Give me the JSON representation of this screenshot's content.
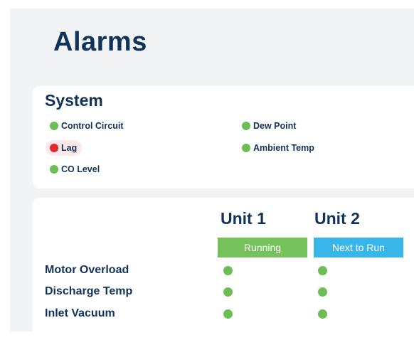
{
  "page": {
    "title": "Alarms"
  },
  "system": {
    "title": "System",
    "alarms": [
      {
        "label": "Control Circuit",
        "status": "ok"
      },
      {
        "label": "Dew Point",
        "status": "ok"
      },
      {
        "label": "Lag",
        "status": "alarm"
      },
      {
        "label": "Ambient Temp",
        "status": "ok"
      },
      {
        "label": "CO Level",
        "status": "ok"
      }
    ]
  },
  "units": {
    "columns": [
      {
        "name": "Unit 1",
        "status_label": "Running",
        "status_color": "#75c25c"
      },
      {
        "name": "Unit 2",
        "status_label": "Next to Run",
        "status_color": "#38b6ea"
      }
    ],
    "rows": [
      {
        "label": "Motor Overload",
        "unit1": "ok",
        "unit2": "ok"
      },
      {
        "label": "Discharge Temp",
        "unit1": "ok",
        "unit2": "ok"
      },
      {
        "label": "Inlet Vacuum",
        "unit1": "ok",
        "unit2": "ok"
      }
    ]
  },
  "colors": {
    "ok": "#6dbd55",
    "alarm": "#e0282e",
    "heading": "#10335a",
    "background": "#f2f3f5"
  }
}
